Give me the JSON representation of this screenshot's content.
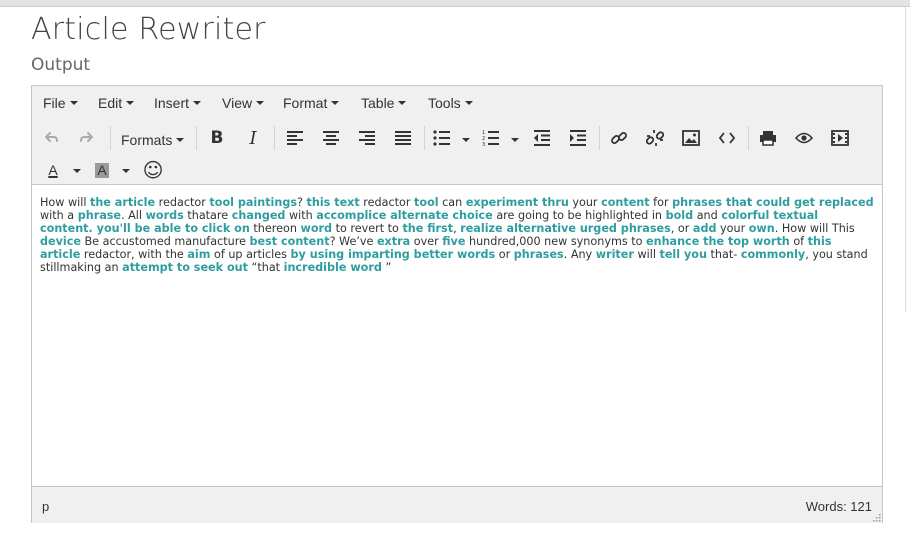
{
  "page": {
    "title": "Article Rewriter",
    "subtitle": "Output"
  },
  "menubar": {
    "items": [
      {
        "label": "File"
      },
      {
        "label": "Edit"
      },
      {
        "label": "Insert"
      },
      {
        "label": "View"
      },
      {
        "label": "Format"
      },
      {
        "label": "Table"
      },
      {
        "label": "Tools"
      }
    ]
  },
  "toolbar": {
    "formats_label": "Formats",
    "bold_glyph": "B",
    "italic_glyph": "I",
    "font_color_glyph": "A",
    "bg_color_glyph": "A",
    "emoticon_glyph": "☺"
  },
  "content": {
    "segments": [
      {
        "t": "How will ",
        "h": false
      },
      {
        "t": "the article",
        "h": true
      },
      {
        "t": " redactor ",
        "h": false
      },
      {
        "t": "tool paintings",
        "h": true
      },
      {
        "t": "? ",
        "h": false
      },
      {
        "t": "this text",
        "h": true
      },
      {
        "t": " redactor ",
        "h": false
      },
      {
        "t": "tool",
        "h": true
      },
      {
        "t": " can ",
        "h": false
      },
      {
        "t": "experiment thru",
        "h": true
      },
      {
        "t": " your ",
        "h": false
      },
      {
        "t": "content",
        "h": true
      },
      {
        "t": " for ",
        "h": false
      },
      {
        "t": "phrases that could get replaced",
        "h": true
      },
      {
        "t": " with a ",
        "h": false
      },
      {
        "t": "phrase",
        "h": true
      },
      {
        "t": ". All ",
        "h": false
      },
      {
        "t": "words",
        "h": true
      },
      {
        "t": " thatare ",
        "h": false
      },
      {
        "t": "changed",
        "h": true
      },
      {
        "t": " with ",
        "h": false
      },
      {
        "t": "accomplice alternate choice",
        "h": true
      },
      {
        "t": " are going to be highlighted in ",
        "h": false
      },
      {
        "t": "bold",
        "h": true
      },
      {
        "t": " and ",
        "h": false
      },
      {
        "t": "colorful textual content. you'll be able to click on",
        "h": true
      },
      {
        "t": " thereon ",
        "h": false
      },
      {
        "t": "word",
        "h": true
      },
      {
        "t": " to revert to ",
        "h": false
      },
      {
        "t": "the first",
        "h": true
      },
      {
        "t": ", ",
        "h": false
      },
      {
        "t": "realize alternative urged phrases",
        "h": true
      },
      {
        "t": ", or ",
        "h": false
      },
      {
        "t": "add",
        "h": true
      },
      {
        "t": " your ",
        "h": false
      },
      {
        "t": "own",
        "h": true
      },
      {
        "t": ". How will This ",
        "h": false
      },
      {
        "t": "device",
        "h": true
      },
      {
        "t": " Be accustomed manufacture ",
        "h": false
      },
      {
        "t": "best content",
        "h": true
      },
      {
        "t": "? We’ve ",
        "h": false
      },
      {
        "t": "extra",
        "h": true
      },
      {
        "t": " over ",
        "h": false
      },
      {
        "t": "five",
        "h": true
      },
      {
        "t": " hundred,000 new synonyms to ",
        "h": false
      },
      {
        "t": "enhance the top worth",
        "h": true
      },
      {
        "t": " of ",
        "h": false
      },
      {
        "t": "this article",
        "h": true
      },
      {
        "t": " redactor, with the ",
        "h": false
      },
      {
        "t": "aim",
        "h": true
      },
      {
        "t": " of up articles ",
        "h": false
      },
      {
        "t": "by using imparting better words",
        "h": true
      },
      {
        "t": " or ",
        "h": false
      },
      {
        "t": "phrases",
        "h": true
      },
      {
        "t": ". Any ",
        "h": false
      },
      {
        "t": "writer",
        "h": true
      },
      {
        "t": " will ",
        "h": false
      },
      {
        "t": "tell you",
        "h": true
      },
      {
        "t": " that- ",
        "h": false
      },
      {
        "t": "commonly",
        "h": true
      },
      {
        "t": ", you stand stillmaking an ",
        "h": false
      },
      {
        "t": "attempt to seek out",
        "h": true
      },
      {
        "t": " “that ",
        "h": false
      },
      {
        "t": "incredible word",
        "h": true
      },
      {
        "t": " ”",
        "h": false
      }
    ]
  },
  "statusbar": {
    "path": "p",
    "word_count": "Words: 121"
  },
  "colors": {
    "highlight": "#2e9ea0",
    "toolbar_bg": "#f0f0f0",
    "border": "#c5c5c5"
  },
  "icons": [
    "undo-icon",
    "redo-icon",
    "bold-icon",
    "italic-icon",
    "align-left-icon",
    "align-center-icon",
    "align-right-icon",
    "align-justify-icon",
    "bullet-list-icon",
    "numbered-list-icon",
    "outdent-icon",
    "indent-icon",
    "link-icon",
    "unlink-icon",
    "image-icon",
    "code-icon",
    "print-icon",
    "preview-icon",
    "media-icon",
    "font-color-icon",
    "background-color-icon",
    "emoticon-icon"
  ]
}
